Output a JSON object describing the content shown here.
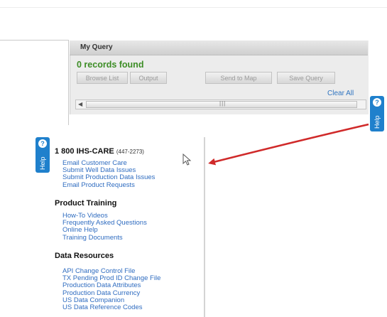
{
  "query_panel": {
    "title": "My Query",
    "records_text": "0 records found",
    "buttons": {
      "browse_list": "Browse List",
      "output": "Output",
      "send_to_map": "Send to Map",
      "save_query": "Save Query"
    },
    "clear_all": "Clear All"
  },
  "help_tab": {
    "label": "Help",
    "icon_glyph": "?"
  },
  "support_panel": {
    "phone_main": "1 800 IHS-CARE",
    "phone_numeric": "(447-2273)",
    "contact_links": [
      "Email Customer Care",
      "Submit Well Data Issues",
      "Submit Production Data Issues",
      "Email Product Requests"
    ],
    "training_title": "Product Training",
    "training_links": [
      "How-To Videos",
      "Frequently Asked Questions",
      "Online Help",
      "Training Documents"
    ],
    "resources_title": "Data Resources",
    "resources_links": [
      "API Change Control File",
      "TX Pending Prod ID Change File",
      "Production Data Attributes",
      "Production Data Currency",
      "US Data Companion",
      "US Data Reference Codes"
    ]
  },
  "colors": {
    "link": "#2f6cc0",
    "records_green": "#3c8d25",
    "help_blue": "#1f80cc",
    "arrow_red": "#d02a2a"
  }
}
